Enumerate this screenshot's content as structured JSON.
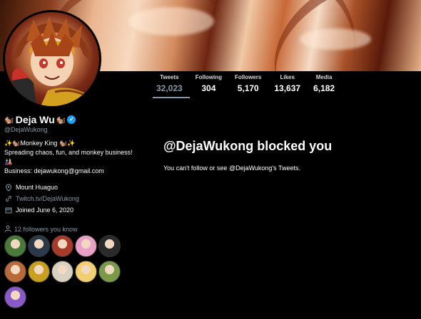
{
  "profile": {
    "display_name": "Deja Wu",
    "handle": "@DejaWukong",
    "bio_line1": "✨🐿️Monkey King 🐿️✨",
    "bio_line2": "Spreading chaos, fun, and monkey business! 🎎",
    "bio_line3": "Business: dejawukong@gmail.com",
    "location": "Mount Huaguo",
    "link": "Twitch.tv/DejaWukong",
    "joined": "Joined June 6, 2020",
    "verified": true
  },
  "stats": [
    {
      "label": "Tweets",
      "value": "32,023",
      "active": true
    },
    {
      "label": "Following",
      "value": "304"
    },
    {
      "label": "Followers",
      "value": "5,170"
    },
    {
      "label": "Likes",
      "value": "13,637"
    },
    {
      "label": "Media",
      "value": "6,182"
    }
  ],
  "followers_you_know": {
    "label": "12 followers you know",
    "avatars": [
      {
        "color": "#4a7a3a"
      },
      {
        "color": "#2a3a4a"
      },
      {
        "color": "#a83a2a"
      },
      {
        "color": "#e8a0c8"
      },
      {
        "color": "#2a2a2a"
      },
      {
        "color": "#b86a3a"
      },
      {
        "color": "#c8a020"
      },
      {
        "color": "#d8d0c0"
      },
      {
        "color": "#f0d070"
      },
      {
        "color": "#7a9a4a"
      },
      {
        "color": "#8a5ac8"
      }
    ]
  },
  "blocked": {
    "title": "@DejaWukong blocked you",
    "subtitle": "You can't follow or see @DejaWukong's Tweets."
  },
  "icons": {
    "location": "map-pin-icon",
    "link": "link-icon",
    "joined": "calendar-icon",
    "followers": "person-icon",
    "verified": "verified-badge-icon"
  },
  "colors": {
    "background": "#000000",
    "secondary_text": "#8899a6",
    "verified": "#1da1f2"
  }
}
